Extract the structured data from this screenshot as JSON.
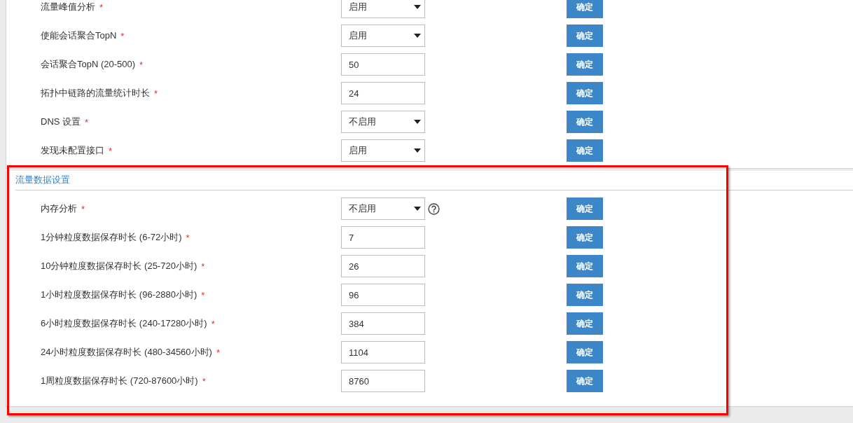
{
  "sections": [
    {
      "rows": [
        {
          "label": "流量峰值分析",
          "required_mark": "*",
          "kind": "select",
          "value": "启用",
          "button": "确定"
        },
        {
          "label": "使能会话聚合TopN",
          "required_mark": "*",
          "kind": "select",
          "value": "启用",
          "button": "确定"
        },
        {
          "label": "会话聚合TopN (20-500)",
          "required_mark": "*",
          "kind": "input",
          "value": "50",
          "button": "确定"
        },
        {
          "label": "拓扑中链路的流量统计时长",
          "required_mark": "*",
          "kind": "input",
          "value": "24",
          "button": "确定"
        },
        {
          "label": "DNS 设置",
          "required_mark": "*",
          "kind": "select",
          "value": "不启用",
          "button": "确定"
        },
        {
          "label": "发现未配置接口",
          "required_mark": "*",
          "kind": "select",
          "value": "启用",
          "button": "确定"
        }
      ]
    },
    {
      "title": "流量数据设置",
      "highlighted": true,
      "rows": [
        {
          "label": "内存分析",
          "required_mark": "*",
          "kind": "select",
          "value": "不启用",
          "help": true,
          "button": "确定"
        },
        {
          "label": "1分钟粒度数据保存时长 (6-72小时)",
          "required_mark": "*",
          "kind": "input",
          "value": "7",
          "button": "确定"
        },
        {
          "label": "10分钟粒度数据保存时长 (25-720小时)",
          "required_mark": "*",
          "kind": "input",
          "value": "26",
          "button": "确定"
        },
        {
          "label": "1小时粒度数据保存时长 (96-2880小时)",
          "required_mark": "*",
          "kind": "input",
          "value": "96",
          "button": "确定"
        },
        {
          "label": "6小时粒度数据保存时长 (240-17280小时)",
          "required_mark": "*",
          "kind": "input",
          "value": "384",
          "button": "确定"
        },
        {
          "label": "24小时粒度数据保存时长 (480-34560小时)",
          "required_mark": "*",
          "kind": "input",
          "value": "1104",
          "button": "确定"
        },
        {
          "label": "1周粒度数据保存时长 (720-87600小时)",
          "required_mark": "*",
          "kind": "input",
          "value": "8760",
          "button": "确定"
        }
      ]
    }
  ]
}
